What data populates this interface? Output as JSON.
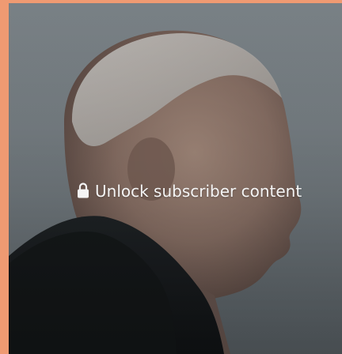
{
  "gate": {
    "label": "Unlock subscriber content",
    "icon": "lock-icon"
  },
  "colors": {
    "frame_accent": "#ef9a72",
    "text": "#f4f4f4"
  }
}
